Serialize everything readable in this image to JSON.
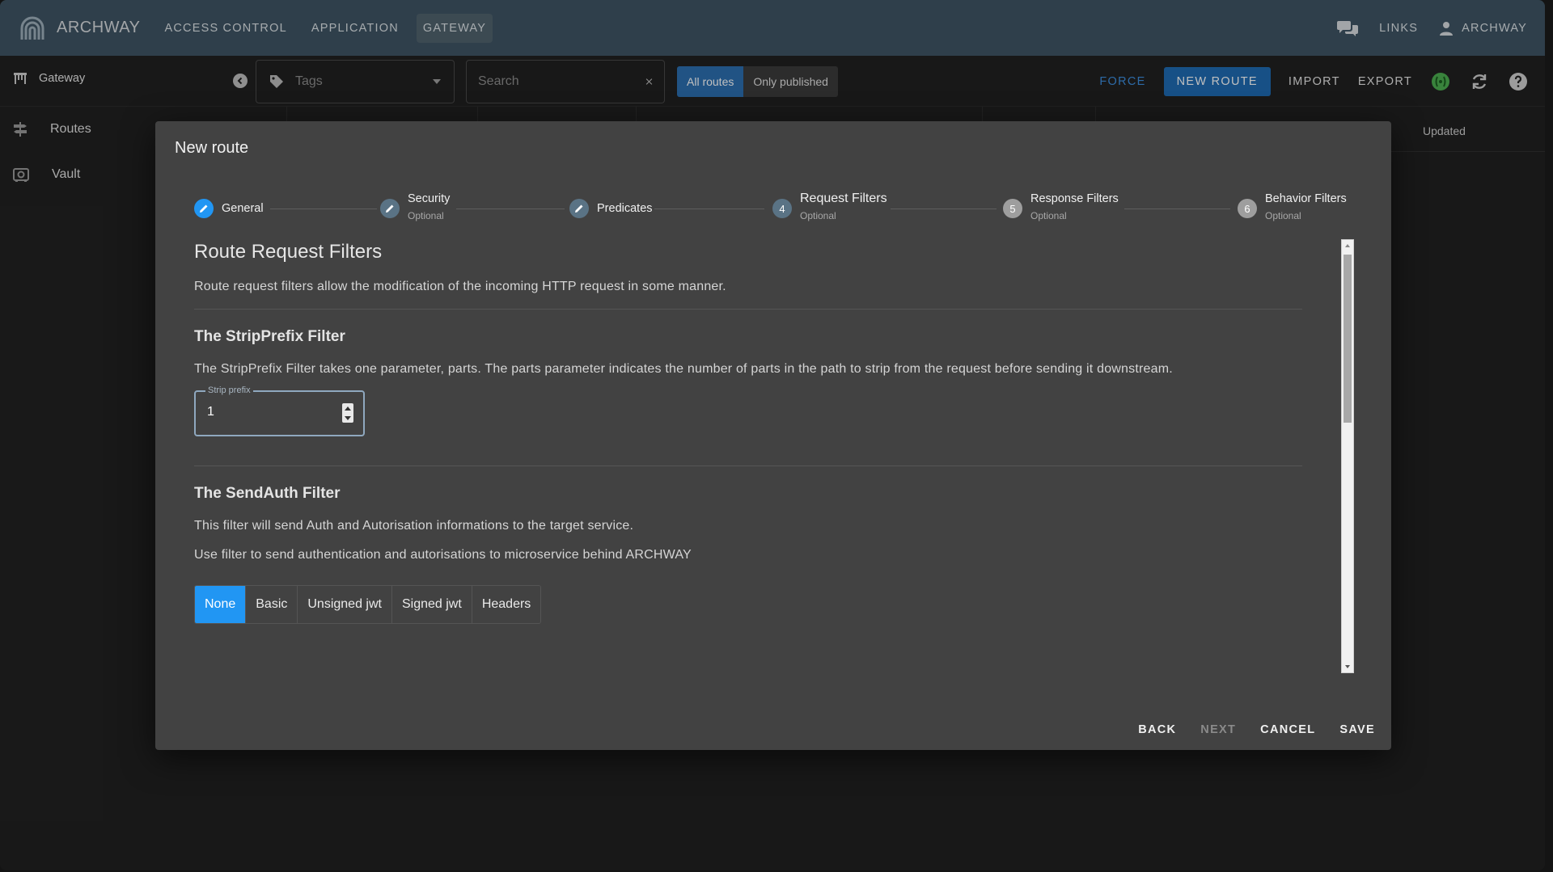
{
  "app": {
    "brand": "ARCHWAY",
    "nav": [
      {
        "label": "ACCESS CONTROL",
        "active": false
      },
      {
        "label": "APPLICATION",
        "active": false
      },
      {
        "label": "GATEWAY",
        "active": true
      }
    ],
    "links_label": "LINKS",
    "user_label": "ARCHWAY"
  },
  "toolbar": {
    "title": "Gateway",
    "tags_placeholder": "Tags",
    "search_placeholder": "Search",
    "filter_options": [
      {
        "label": "All routes",
        "selected": true
      },
      {
        "label": "Only published",
        "selected": false
      }
    ],
    "force_label": "FORCE",
    "new_route_label": "NEW ROUTE",
    "import_label": "IMPORT",
    "export_label": "EXPORT"
  },
  "sidebar": {
    "items": [
      {
        "label": "Routes",
        "icon": "routes-icon"
      },
      {
        "label": "Vault",
        "icon": "vault-icon"
      }
    ]
  },
  "table": {
    "updated_header": "Updated"
  },
  "dialog": {
    "title": "New route",
    "steps": [
      {
        "number": "",
        "label": "General",
        "optional": "",
        "state": "edit"
      },
      {
        "number": "",
        "label": "Security",
        "optional": "Optional",
        "state": "edit"
      },
      {
        "number": "",
        "label": "Predicates",
        "optional": "",
        "state": "edit"
      },
      {
        "number": "4",
        "label": "Request Filters",
        "optional": "Optional",
        "state": "active"
      },
      {
        "number": "5",
        "label": "Response Filters",
        "optional": "Optional",
        "state": "todo"
      },
      {
        "number": "6",
        "label": "Behavior Filters",
        "optional": "Optional",
        "state": "todo"
      }
    ],
    "section_title": "Route Request Filters",
    "section_desc": "Route request filters allow the modification of the incoming HTTP request in some manner.",
    "strip": {
      "title": "The StripPrefix Filter",
      "desc": "The StripPrefix Filter takes one parameter, parts. The parts parameter indicates the number of parts in the path to strip from the request before sending it downstream.",
      "field_label": "Strip prefix",
      "field_value": "1"
    },
    "sendauth": {
      "title": "The SendAuth Filter",
      "desc1": "This filter will send Auth and Autorisation informations to the target service.",
      "desc2": "Use filter to send authentication and autorisations to microservice behind ARCHWAY",
      "options": [
        {
          "label": "None",
          "selected": true
        },
        {
          "label": "Basic",
          "selected": false
        },
        {
          "label": "Unsigned jwt",
          "selected": false
        },
        {
          "label": "Signed jwt",
          "selected": false
        },
        {
          "label": "Headers",
          "selected": false
        }
      ]
    },
    "actions": {
      "back": "BACK",
      "next": "NEXT",
      "cancel": "CANCEL",
      "save": "SAVE"
    }
  },
  "colors": {
    "appbar": "#3f5564",
    "primary": "#2196f3",
    "primary_dark": "#1f6bb3",
    "dialog_bg": "#424242",
    "page_bg": "#212121"
  }
}
